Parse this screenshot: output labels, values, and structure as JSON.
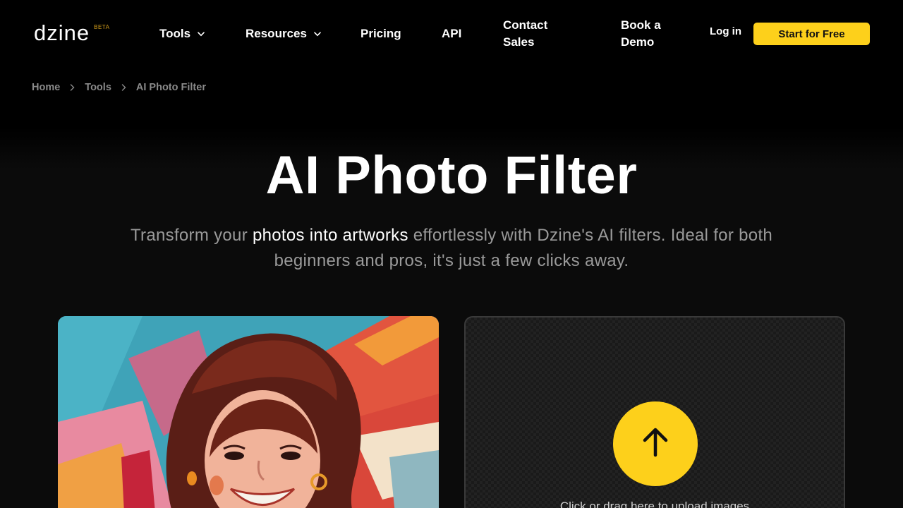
{
  "brand": {
    "name": "dzine",
    "badge": "BETA",
    "accent": "#fdd01b"
  },
  "nav": {
    "items": [
      {
        "label": "Tools",
        "dropdown": true
      },
      {
        "label": "Resources",
        "dropdown": true
      },
      {
        "label": "Pricing"
      },
      {
        "label": "API"
      },
      {
        "label": "Contact Sales"
      },
      {
        "label": "Book a Demo"
      }
    ],
    "login": "Log in",
    "cta": "Start for Free"
  },
  "breadcrumb": [
    "Home",
    "Tools",
    "AI Photo Filter"
  ],
  "hero": {
    "title": "AI Photo Filter",
    "subtitle_before": "Transform your ",
    "subtitle_highlight": "photos into artworks",
    "subtitle_after": " effortlessly with Dzine's AI filters. Ideal for both beginners and pros, it's just a few clicks away."
  },
  "upload": {
    "text": "Click or drag here to upload images",
    "icon": "upload-arrow-icon"
  },
  "icons": {
    "dropdown": "chevron-down-icon",
    "breadcrumb_separator": "chevron-right-icon"
  }
}
